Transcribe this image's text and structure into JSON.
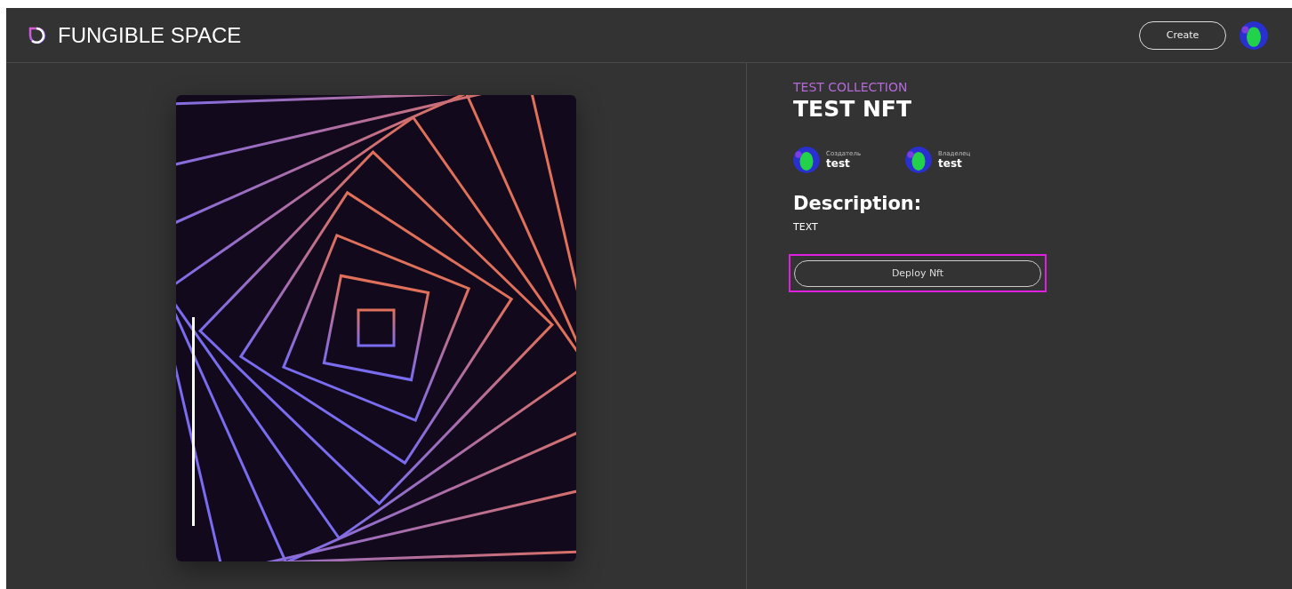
{
  "header": {
    "brand": "FUNGIBLE SPACE",
    "create_button": "Create"
  },
  "nft": {
    "collection": "TEST COLLECTION",
    "title": "TEST NFT",
    "people": [
      {
        "role": "Создатель",
        "name": "test"
      },
      {
        "role": "Владелец",
        "name": "test"
      }
    ],
    "description_heading": "Description:",
    "description": "TEXT",
    "deploy_button": {
      "label": "Deploy Nft",
      "focused": true
    }
  }
}
